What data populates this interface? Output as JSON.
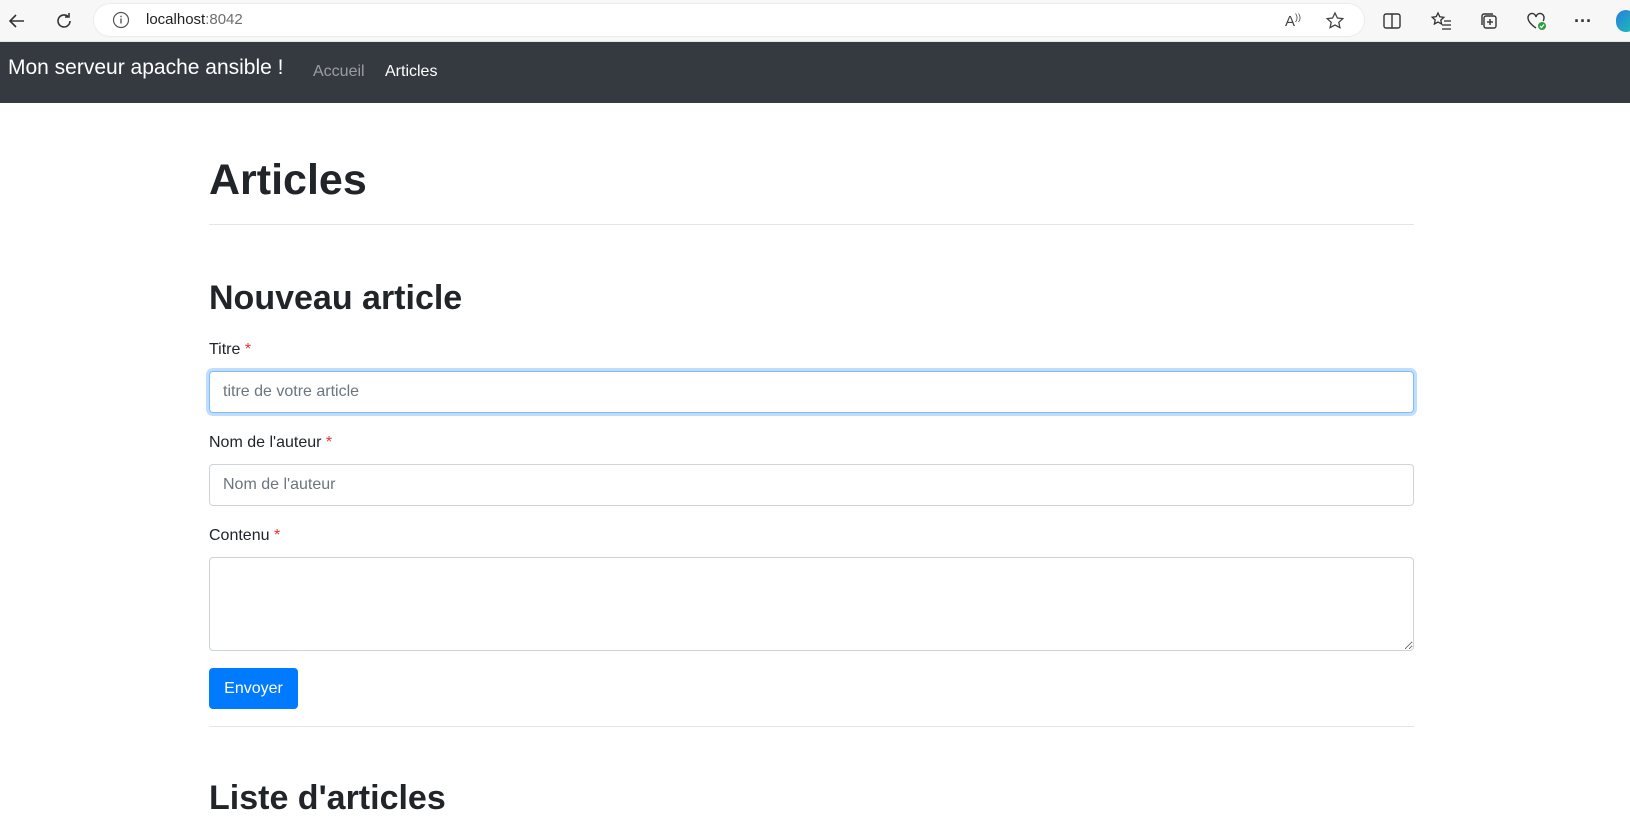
{
  "browser": {
    "url_host": "localhost",
    "url_port": ":8042",
    "read_aloud_glyph": "A"
  },
  "navbar": {
    "brand": "Mon serveur apache ansible !",
    "links": [
      {
        "label": "Accueil",
        "active": false
      },
      {
        "label": "Articles",
        "active": true
      }
    ]
  },
  "page": {
    "title": "Articles"
  },
  "form": {
    "heading": "Nouveau article",
    "required_marker": "*",
    "title_label": "Titre",
    "title_placeholder": "titre de votre article",
    "title_value": "",
    "author_label": "Nom de l'auteur",
    "author_placeholder": "Nom de l'auteur",
    "author_value": "",
    "content_label": "Contenu",
    "content_value": "",
    "submit_label": "Envoyer"
  },
  "list": {
    "heading": "Liste d'articles"
  },
  "colors": {
    "navbar_bg": "#343a40",
    "primary": "#007bff",
    "required": "#e3342f"
  }
}
